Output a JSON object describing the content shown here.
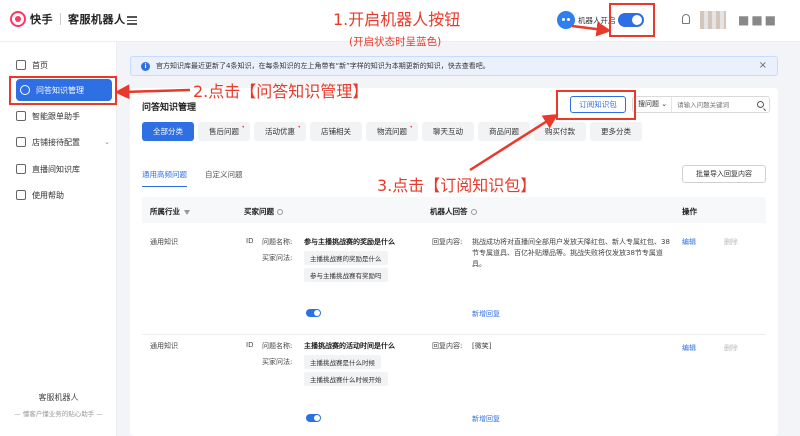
{
  "topbar": {
    "brand": "快手",
    "product": "客服机器人",
    "robot_switch_label": "机器人开启",
    "robot_switch_on": true,
    "accent_color": "#2f6fe4"
  },
  "sidebar": {
    "items": [
      {
        "label": "首页",
        "icon": "home-icon"
      },
      {
        "label": "问答知识管理",
        "icon": "qa-icon",
        "active": true
      },
      {
        "label": "智能跟单助手",
        "icon": "assistant-icon"
      },
      {
        "label": "店铺接待配置",
        "icon": "store-icon",
        "has_submenu": true
      },
      {
        "label": "直播间知识库",
        "icon": "live-icon"
      },
      {
        "label": "使用帮助",
        "icon": "help-icon"
      }
    ],
    "footer_title": "客服机器人",
    "footer_subtitle": "— 懂客户懂业务的贴心助手 —"
  },
  "notice": {
    "text": "官方知识库最近更新了4条知识，在每条知识的左上角带有“新”字样的知识为本期更新的知识，快去查看吧。"
  },
  "main": {
    "title": "问答知识管理",
    "subscribe_label": "订阅知识包",
    "search_type": "搜问题",
    "search_placeholder": "请输入问题关键词",
    "categories": [
      {
        "label": "全部分类",
        "active": true,
        "dot": false
      },
      {
        "label": "售后问题",
        "active": false,
        "dot": true
      },
      {
        "label": "活动优惠",
        "active": false,
        "dot": true
      },
      {
        "label": "店铺相关",
        "active": false,
        "dot": false
      },
      {
        "label": "物流问题",
        "active": false,
        "dot": true
      },
      {
        "label": "聊天互动",
        "active": false,
        "dot": false
      },
      {
        "label": "商品问题",
        "active": false,
        "dot": false
      },
      {
        "label": "购买付款",
        "active": false,
        "dot": false
      },
      {
        "label": "更多分类",
        "active": false,
        "dot": false
      }
    ],
    "subtabs": [
      {
        "label": "通用高频问题",
        "active": true
      },
      {
        "label": "自定义问题",
        "active": false
      }
    ],
    "import_label": "批量导入回复内容",
    "table": {
      "headers": {
        "industry": "所属行业",
        "buyer_question": "买家问题",
        "robot_answer": "机器人回答",
        "actions": "操作"
      },
      "rows": [
        {
          "industry": "通用知识",
          "id_label": "ID",
          "qname_label": "问题名称:",
          "qname": "参与主播挑战赛的奖励是什么",
          "alt_label": "买家问法:",
          "alt_questions": [
            "主播挑战赛的奖励是什么",
            "参与主播挑战赛有奖励吗"
          ],
          "enabled": true,
          "reply_label": "回复内容:",
          "reply": "挑战成功将对直播间全部用户发放天降红包、新人专属红包、38节专属道具、百亿补贴爆品等。挑战失败将仅发放38节专属道具。",
          "add_reply": "新增回复",
          "edit": "编辑",
          "delete": "删除"
        },
        {
          "industry": "通用知识",
          "id_label": "ID",
          "qname_label": "问题名称:",
          "qname": "主播挑战赛的活动时间是什么",
          "alt_label": "买家问法:",
          "alt_questions": [
            "主播挑战赛是什么时候",
            "主播挑战赛什么时候开始"
          ],
          "enabled": true,
          "reply_label": "回复内容:",
          "reply": "[微笑]",
          "add_reply": "新增回复",
          "edit": "编辑",
          "delete": "删除"
        }
      ]
    }
  },
  "annotations": {
    "step1": "1.开启机器人按钮",
    "step1_note": "(开启状态时呈蓝色)",
    "step2": "2.点击【问答知识管理】",
    "step3": "3.点击【订阅知识包】",
    "color": "#e8392a"
  }
}
